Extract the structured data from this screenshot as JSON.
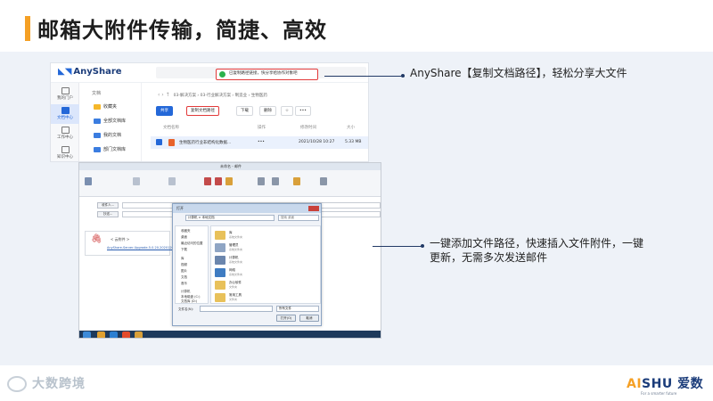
{
  "slide": {
    "title": "邮箱大附件传输，简捷、高效",
    "accent_color": "#f5a025"
  },
  "anyshare": {
    "logo": "AnyShare",
    "toast": "已复制路径链接，快分享给协作对象吧",
    "nav": [
      {
        "label": "我的门户",
        "icon": "home-icon"
      },
      {
        "label": "文档中心",
        "icon": "folder-icon",
        "active": true
      },
      {
        "label": "工作中心",
        "icon": "grid-icon"
      },
      {
        "label": "知识中心",
        "icon": "book-icon"
      },
      {
        "label": "管理中心",
        "icon": "settings-icon"
      }
    ],
    "tree": {
      "header": "文档",
      "items": [
        "收藏夹",
        "全部文档库",
        "我的文档",
        "部门文档库"
      ]
    },
    "breadcrumb": "03-解决方案  ›  03-行业解决方案  ›  制造业  ›  生物医药",
    "toolbar": {
      "share": "共享",
      "copy_path": "复制文档路径",
      "download": "下载",
      "delete": "删除"
    },
    "table": {
      "headers": [
        "文档名称",
        "操作",
        "修改时间",
        "大小"
      ],
      "row": {
        "name": "生物医药行业非结构化数据...",
        "actions": "•••",
        "modified": "2021/10/28 10:27",
        "size": "5.33 MB"
      }
    }
  },
  "mail": {
    "window_title": "未命名 - 邮件",
    "to_label": "收件人...",
    "cc_label": "抄送...",
    "attachment_label": "< 云附件 >",
    "attachment_link": "AnyShare-Server-Upgrade-5.0.20-20201200-Tr..."
  },
  "file_dialog": {
    "title": "打开",
    "address": "计算机 > 本地文档",
    "search": "搜索 桌面",
    "left": [
      "收藏夹",
      "桌面",
      "最近访问的位置",
      "下载",
      "库",
      "视频",
      "图片",
      "文档",
      "音乐",
      "计算机",
      "本地磁盘 (C:)",
      "文档库 (D:)"
    ],
    "files": [
      {
        "name": "库",
        "sub": "系统文件夹"
      },
      {
        "name": "管理员",
        "sub": "系统文件夹"
      },
      {
        "name": "计算机",
        "sub": "系统文件夹"
      },
      {
        "name": "网络",
        "sub": "系统文件夹"
      },
      {
        "name": "办公软件",
        "sub": "文件夹"
      },
      {
        "name": "常用工具",
        "sub": "文件夹"
      }
    ],
    "filename_label": "文件名(N):",
    "filetype": "所有文件",
    "open_button": "打开(O)",
    "cancel_button": "取消"
  },
  "callouts": {
    "first": "AnyShare【复制文档路径】，轻松分享大文件",
    "second": "一键添加文件路径，快速插入文件附件，一键更新，无需多次发送邮件"
  },
  "footer": {
    "left_brand": "大数跨境",
    "right_brand_a": "AI",
    "right_brand_rest": "SHU 爱数",
    "tagline": "For a smarter future"
  }
}
